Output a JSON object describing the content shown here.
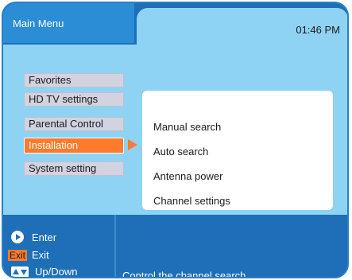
{
  "header": {
    "title": "Main Menu",
    "clock": "01:46 PM"
  },
  "menu": {
    "items": [
      {
        "label": "Favorites"
      },
      {
        "label": "HD TV settings"
      },
      {
        "label": "Parental Control"
      },
      {
        "label": "Installation",
        "active": true
      },
      {
        "label": "System setting"
      }
    ]
  },
  "submenu": {
    "items": [
      {
        "label": "Manual search"
      },
      {
        "label": "Auto  search"
      },
      {
        "label": "Antenna power"
      },
      {
        "label": "Channel settings"
      }
    ]
  },
  "footer": {
    "enter_label": "Enter",
    "exit_key": "Exit",
    "exit_label": "Exit",
    "updown_label": "Up/Down",
    "help_text": "Control the channel search"
  },
  "colors": {
    "frame": "#1e6fb8",
    "panel": "#8ed3f4",
    "highlight": "#ff7a2a",
    "menu_item": "#d2d2e0"
  },
  "icons": [
    "play-icon",
    "exit-key-icon",
    "up-down-icon",
    "selection-arrow-icon"
  ]
}
